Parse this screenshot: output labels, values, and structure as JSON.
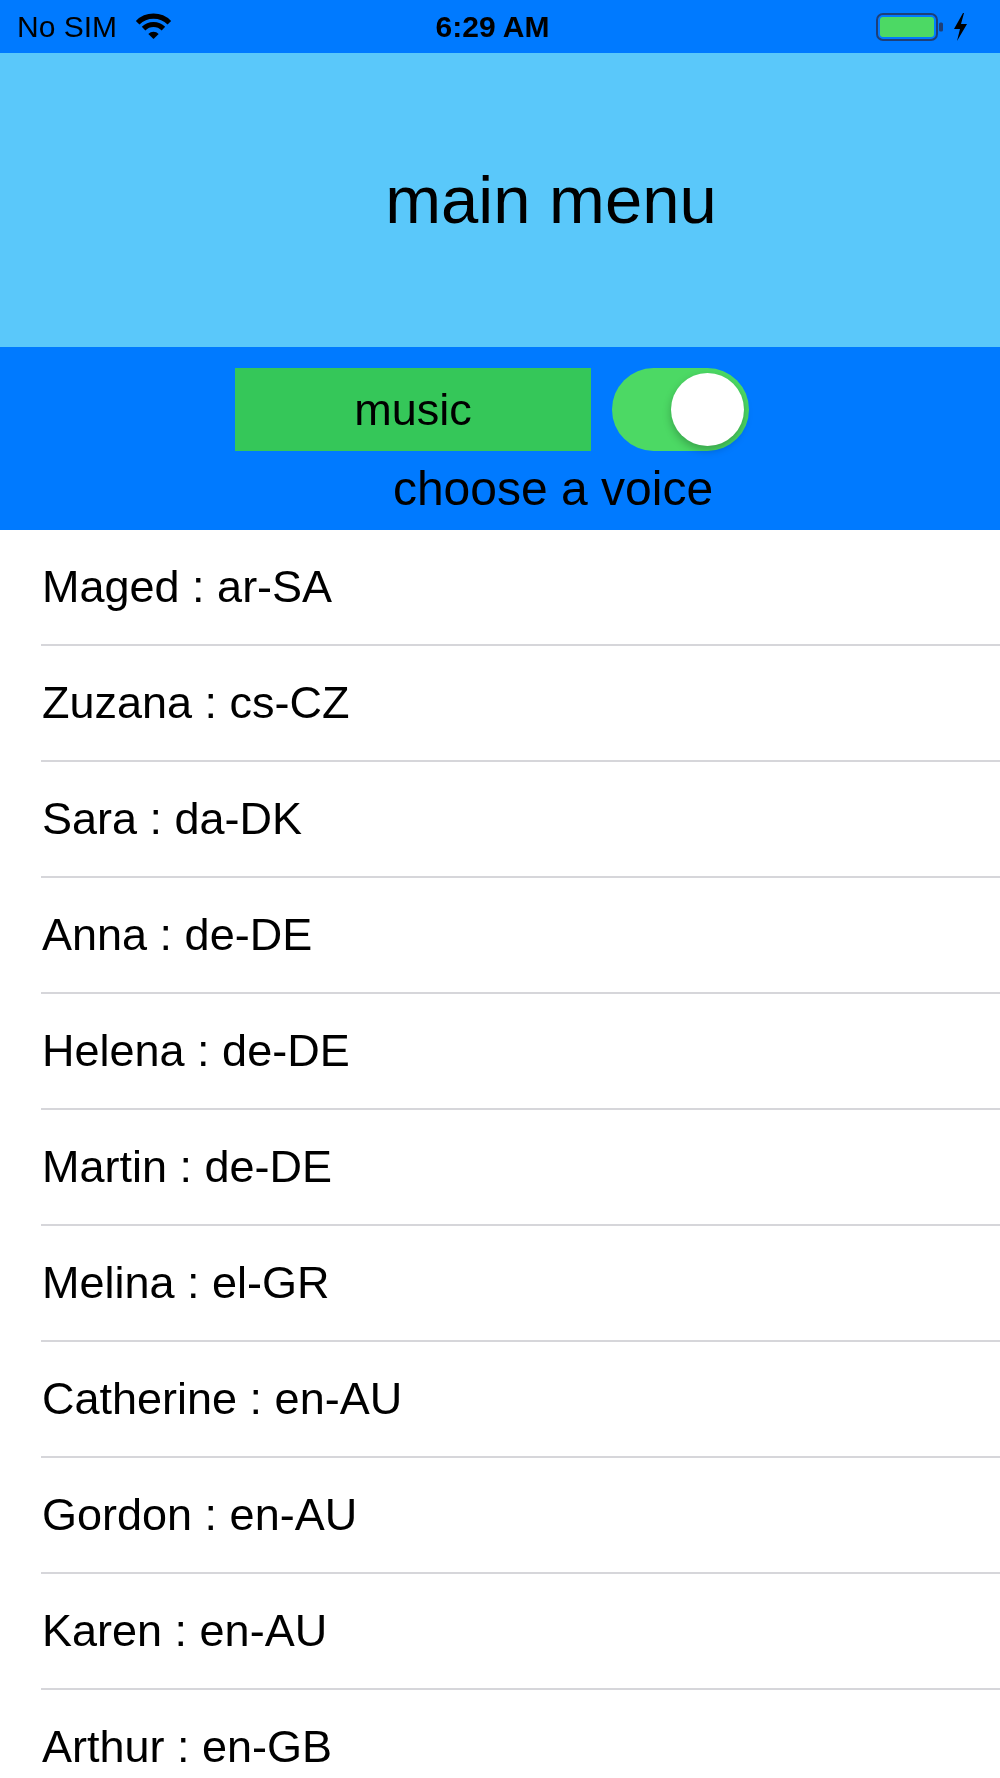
{
  "status_bar": {
    "carrier": "No SIM",
    "time": "6:29 AM"
  },
  "header": {
    "title": "main menu"
  },
  "controls": {
    "music_button": {
      "label": "music"
    },
    "music_switch": {
      "on": true
    },
    "prompt": "choose a voice"
  },
  "voices": [
    {
      "label": "Maged : ar-SA",
      "selected": false
    },
    {
      "label": "Zuzana : cs-CZ",
      "selected": false
    },
    {
      "label": "Sara : da-DK",
      "selected": false
    },
    {
      "label": "Anna : de-DE",
      "selected": false
    },
    {
      "label": "Helena : de-DE",
      "selected": false
    },
    {
      "label": "Martin : de-DE",
      "selected": false
    },
    {
      "label": "Melina : el-GR",
      "selected": false
    },
    {
      "label": "Catherine : en-AU",
      "selected": false
    },
    {
      "label": "Gordon : en-AU",
      "selected": false
    },
    {
      "label": "Karen : en-AU",
      "selected": false
    },
    {
      "label": "Arthur : en-GB",
      "selected": false
    }
  ]
}
